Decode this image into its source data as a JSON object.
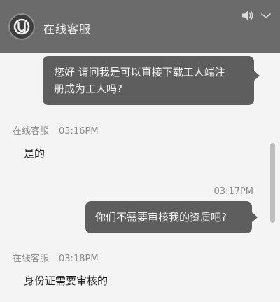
{
  "header": {
    "title": "在线客服",
    "avatar_icon": "brand-logo-icon",
    "volume_icon": "volume-icon",
    "menu_icon": "chevron-down-icon"
  },
  "messages": [
    {
      "from": "user",
      "text_line1": "您好 请问我是可以直接下载工人端注",
      "text_line2": "册成为工人吗?"
    },
    {
      "from": "agent",
      "sender": "在线客服",
      "time": "03:16PM",
      "text": "是的"
    },
    {
      "from": "user",
      "time": "03:17PM",
      "text": "你们不需要审核我的资质吧?"
    },
    {
      "from": "agent",
      "sender": "在线客服",
      "time": "03:18PM",
      "text": "身份证需要审核的"
    }
  ],
  "colors": {
    "header_bg": "#6b6b6b",
    "bubble_bg": "#5e5e5e",
    "chat_bg": "#f4f4f4"
  }
}
